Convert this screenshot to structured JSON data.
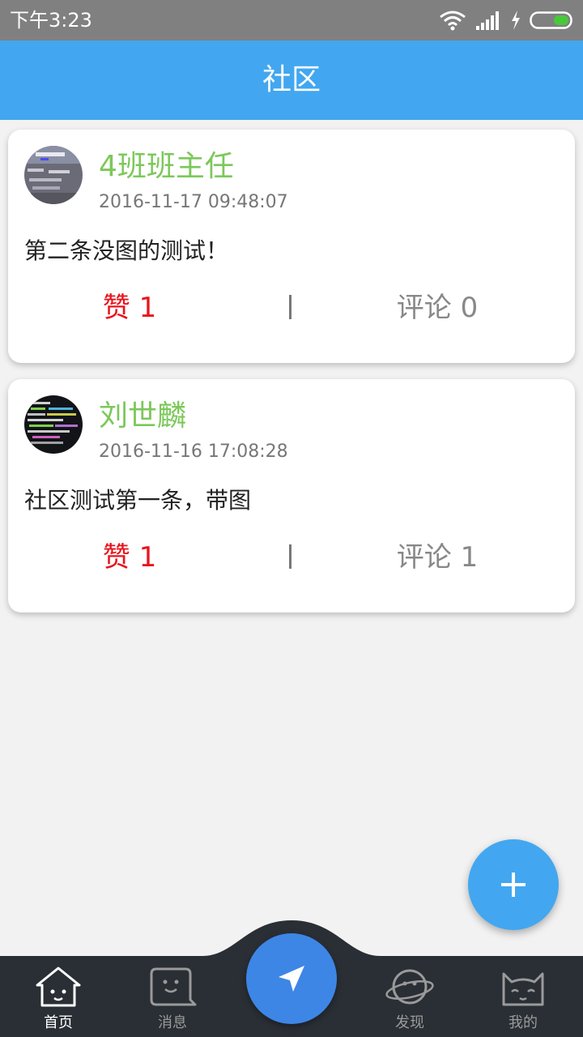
{
  "status_bar": {
    "time": "下午3:23",
    "icons": [
      "wifi-icon",
      "signal-icon",
      "charging-icon",
      "battery-icon"
    ]
  },
  "app_bar": {
    "title": "社区"
  },
  "posts": [
    {
      "author": "4班班主任",
      "time": "2016-11-17 09:48:07",
      "text": "第二条没图的测试！",
      "like_label": "赞 1",
      "comment_label": "评论 0",
      "avatar_icon": "password-screen-avatar"
    },
    {
      "author": "刘世麟",
      "time": "2016-11-16 17:08:28",
      "text": "社区测试第一条，带图",
      "like_label": "赞 1",
      "comment_label": "评论 1",
      "avatar_icon": "code-screen-avatar"
    }
  ],
  "fab": {
    "icon": "plus-icon"
  },
  "bottom_nav": {
    "items": [
      {
        "label": "首页",
        "icon": "home-icon",
        "active": true
      },
      {
        "label": "消息",
        "icon": "message-icon",
        "active": false
      },
      {
        "label": "发现",
        "icon": "planet-icon",
        "active": false
      },
      {
        "label": "我的",
        "icon": "cat-icon",
        "active": false
      }
    ],
    "center_icon": "send-arrow-icon"
  },
  "colors": {
    "app_bar": "#42a7f0",
    "author": "#7cc85a",
    "like": "#e8141c",
    "nav_bg": "#2a2f35",
    "center_button": "#3d86e6"
  }
}
